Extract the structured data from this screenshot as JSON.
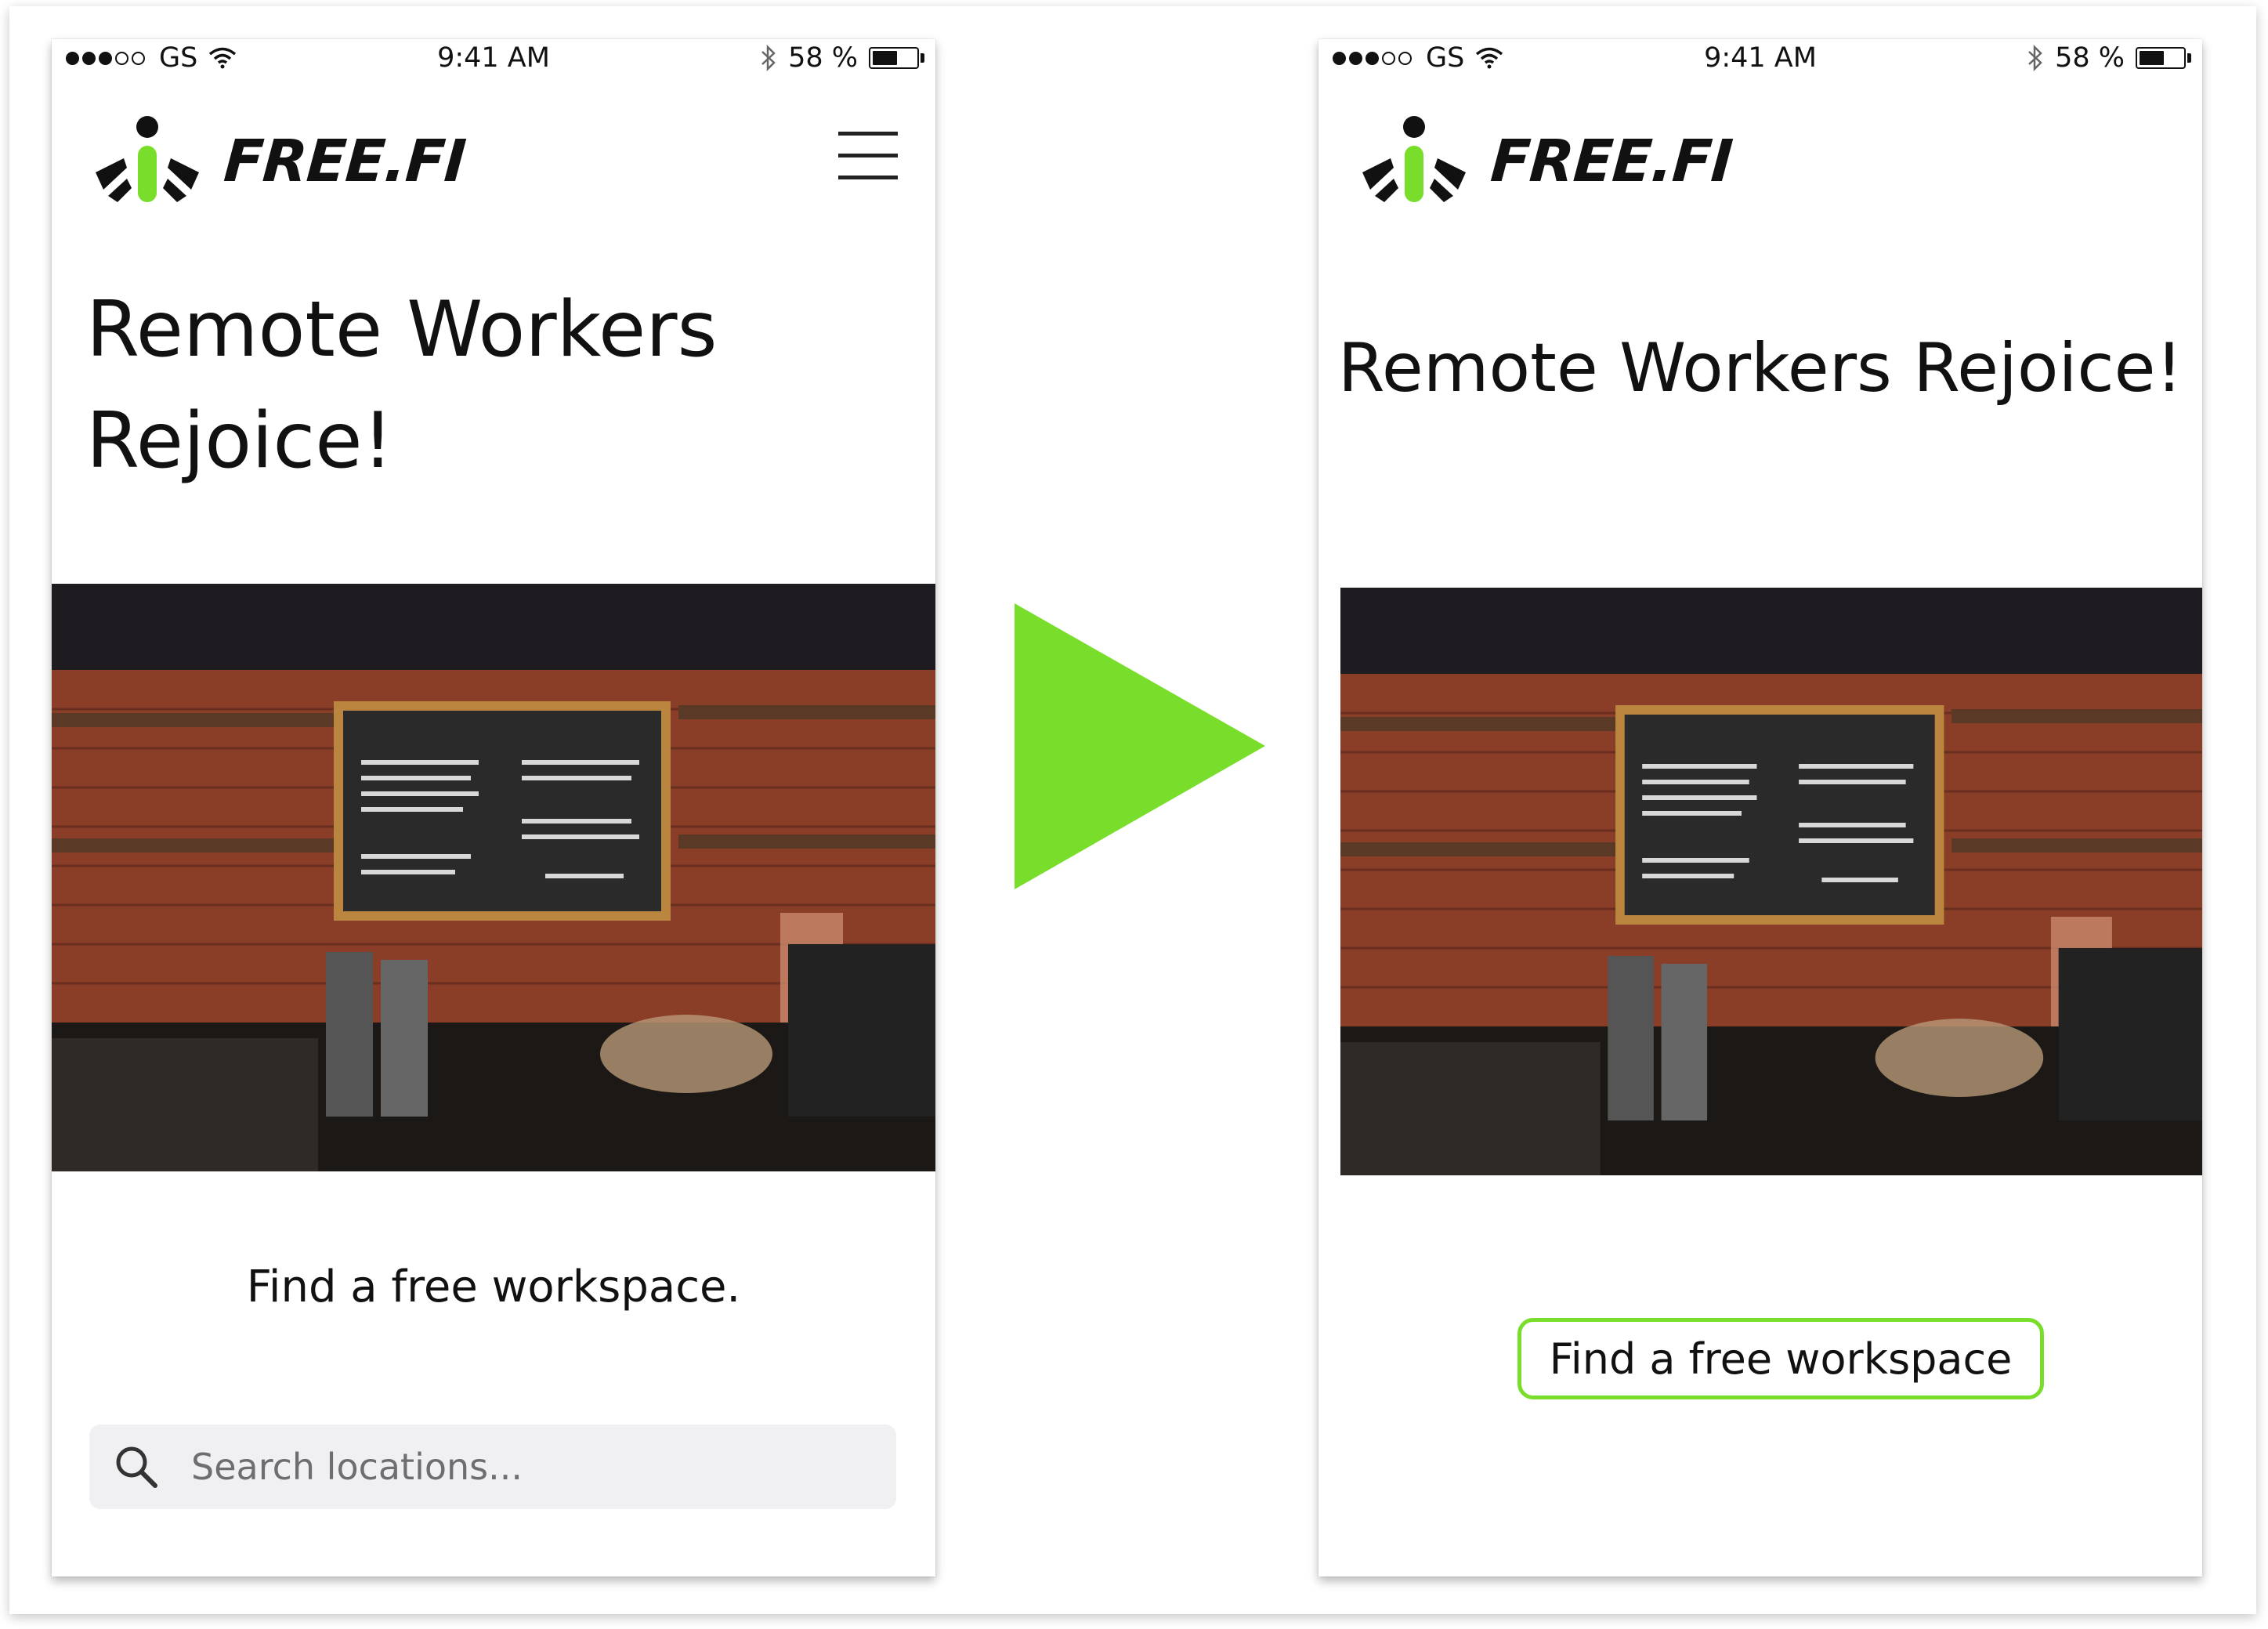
{
  "colors": {
    "accent_green": "#79de2b",
    "text": "#111111",
    "search_bg": "#f0f0f2"
  },
  "status_bar": {
    "carrier": "GS",
    "time": "9:41 AM",
    "battery": "58 %",
    "battery_level": 0.58
  },
  "brand": {
    "name": "FREE.FI"
  },
  "before": {
    "hero_title_line1": "Remote Workers",
    "hero_title_line2": "Rejoice!",
    "subtitle": "Find a free workspace.",
    "search_placeholder": "Search locations..."
  },
  "after": {
    "hero_title": "Remote Workers Rejoice!",
    "cta_label": "Find a free workspace"
  },
  "icons": [
    "signal-dots-icon",
    "wifi-icon",
    "bluetooth-icon",
    "battery-icon",
    "menu-icon",
    "search-icon",
    "play-arrow-icon"
  ]
}
